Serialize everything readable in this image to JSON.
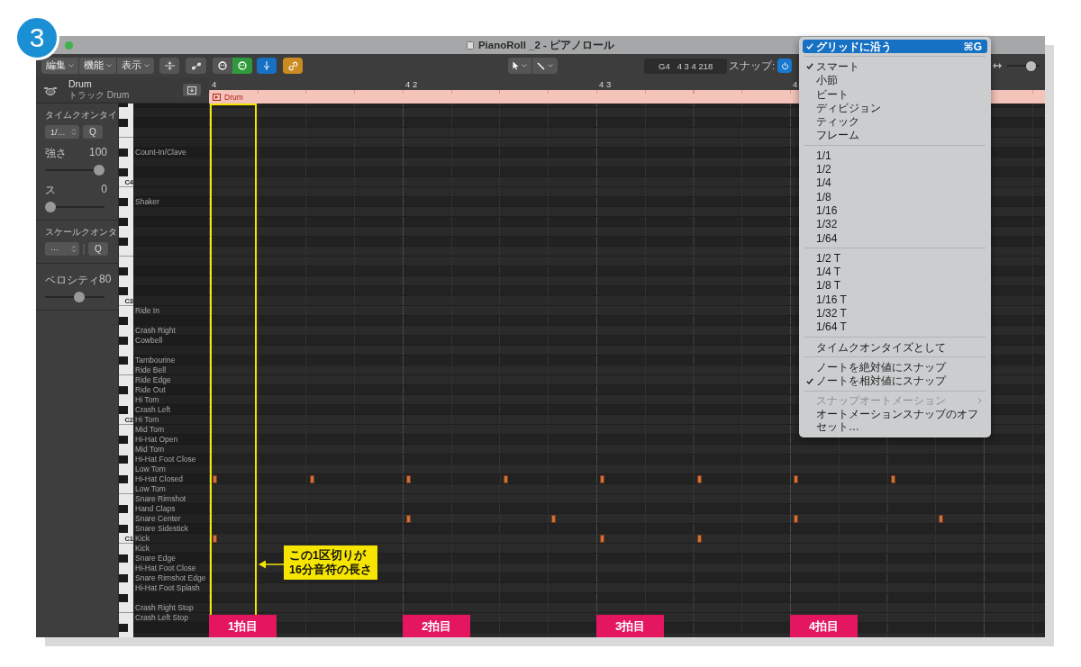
{
  "badge": "3",
  "window": {
    "title": "PianoRoll _2 - ピアノロール"
  },
  "toolbar": {
    "menus": [
      {
        "label": "編集"
      },
      {
        "label": "機能"
      },
      {
        "label": "表示"
      }
    ],
    "midi": [
      {
        "selected": false
      },
      {
        "selected": true
      }
    ],
    "catch_on": true,
    "link_on": true,
    "note": "G4",
    "position": "4 3 4 218",
    "snap_label": "スナップ:",
    "snap_on": true,
    "zoom": {
      "level": 0.85
    }
  },
  "track": {
    "name": "Drum",
    "subtitle": "トラック Drum"
  },
  "inspector": {
    "time_quantize": {
      "title": "タイムクオンタイ",
      "value": "1/…",
      "button": "Q"
    },
    "strength": {
      "label": "強さ",
      "reading": "100",
      "level": 1
    },
    "swing": {
      "label": "ス",
      "reading": "0",
      "level": 0
    },
    "scale_quantize": {
      "title": "スケールクオンタ",
      "value": "···",
      "button": "Q"
    },
    "velocity": {
      "label": "ベロシティ",
      "reading": "80",
      "level": 0.6
    }
  },
  "ruler": {
    "bars": [
      "4",
      "4 2",
      "4 3",
      "4"
    ]
  },
  "region": {
    "name": "Drum"
  },
  "octaves": [
    "C4",
    "C3",
    "C2",
    "C1"
  ],
  "lanes": [
    {
      "drum": "Count-In/Clave"
    },
    {
      "drum": "Shaker"
    },
    {
      "drum": "Ride In"
    },
    {
      "drum": "Crash Right"
    },
    {
      "drum": "Cowbell"
    },
    {
      "drum": "Tambourine"
    },
    {
      "drum": "Ride Bell"
    },
    {
      "drum": "Ride Edge"
    },
    {
      "drum": "Ride Out"
    },
    {
      "drum": "Hi Tom"
    },
    {
      "drum": "Crash Left"
    },
    {
      "drum": "Hi Tom"
    },
    {
      "drum": "Mid Tom"
    },
    {
      "drum": "Hi-Hat Open"
    },
    {
      "drum": "Mid Tom"
    },
    {
      "drum": "Hi-Hat Foot Close"
    },
    {
      "drum": "Low Tom"
    },
    {
      "drum": "Hi-Hat Closed",
      "steps": [
        true,
        false,
        true,
        false,
        true,
        false,
        true,
        false,
        true,
        false,
        true,
        false,
        true,
        false,
        true,
        false
      ]
    },
    {
      "drum": "Low Tom"
    },
    {
      "drum": "Snare Rimshot"
    },
    {
      "drum": "Hand Claps"
    },
    {
      "drum": "Snare Center",
      "steps": [
        false,
        false,
        false,
        false,
        true,
        false,
        false,
        true,
        false,
        false,
        false,
        false,
        true,
        false,
        false,
        true
      ]
    },
    {
      "drum": "Snare Sidestick"
    },
    {
      "drum": "Kick",
      "steps": [
        true,
        false,
        false,
        false,
        false,
        false,
        false,
        false,
        true,
        false,
        true,
        false,
        false,
        false,
        false,
        false
      ]
    },
    {
      "drum": "Kick"
    },
    {
      "drum": "Snare Edge"
    },
    {
      "drum": "Hi-Hat Foot Close"
    },
    {
      "drum": "Snare Rimshot Edge"
    },
    {
      "drum": "Hi-Hat Foot Splash"
    },
    {
      "drum": "Crash Right Stop"
    },
    {
      "drum": "Crash Left Stop"
    }
  ],
  "callout": {
    "lines": [
      "この1区切りが",
      "16分音符の長さ"
    ]
  },
  "beats": [
    "1拍目",
    "2拍目",
    "3拍目",
    "4拍目"
  ],
  "snap_menu": {
    "sections": [
      [
        {
          "label": "グリッドに沿う",
          "shortcut": "⌘G",
          "checked": true,
          "selected": true,
          "disabled": false,
          "has_submenu": false
        }
      ],
      [
        {
          "label": "スマート",
          "checked": true,
          "selected": false,
          "disabled": false,
          "has_submenu": false
        },
        {
          "label": "小節",
          "checked": false,
          "selected": false,
          "disabled": false,
          "has_submenu": false
        },
        {
          "label": "ビート",
          "checked": false,
          "selected": false,
          "disabled": false,
          "has_submenu": false
        },
        {
          "label": "ディビジョン",
          "checked": false,
          "selected": false,
          "disabled": false,
          "has_submenu": false
        },
        {
          "label": "ティック",
          "checked": false,
          "selected": false,
          "disabled": false,
          "has_submenu": false
        },
        {
          "label": "フレーム",
          "checked": false,
          "selected": false,
          "disabled": false,
          "has_submenu": false
        }
      ],
      [
        {
          "label": "1/1",
          "checked": false,
          "selected": false,
          "disabled": false,
          "has_submenu": false
        },
        {
          "label": "1/2",
          "checked": false,
          "selected": false,
          "disabled": false,
          "has_submenu": false
        },
        {
          "label": "1/4",
          "checked": false,
          "selected": false,
          "disabled": false,
          "has_submenu": false
        },
        {
          "label": "1/8",
          "checked": false,
          "selected": false,
          "disabled": false,
          "has_submenu": false
        },
        {
          "label": "1/16",
          "checked": false,
          "selected": false,
          "disabled": false,
          "has_submenu": false
        },
        {
          "label": "1/32",
          "checked": false,
          "selected": false,
          "disabled": false,
          "has_submenu": false
        },
        {
          "label": "1/64",
          "checked": false,
          "selected": false,
          "disabled": false,
          "has_submenu": false
        }
      ],
      [
        {
          "label": "1/2 T",
          "checked": false,
          "selected": false,
          "disabled": false,
          "has_submenu": false
        },
        {
          "label": "1/4 T",
          "checked": false,
          "selected": false,
          "disabled": false,
          "has_submenu": false
        },
        {
          "label": "1/8 T",
          "checked": false,
          "selected": false,
          "disabled": false,
          "has_submenu": false
        },
        {
          "label": "1/16 T",
          "checked": false,
          "selected": false,
          "disabled": false,
          "has_submenu": false
        },
        {
          "label": "1/32 T",
          "checked": false,
          "selected": false,
          "disabled": false,
          "has_submenu": false
        },
        {
          "label": "1/64 T",
          "checked": false,
          "selected": false,
          "disabled": false,
          "has_submenu": false
        }
      ],
      [
        {
          "label": "タイムクオンタイズとして",
          "checked": false,
          "selected": false,
          "disabled": false,
          "has_submenu": false
        }
      ],
      [
        {
          "label": "ノートを絶対値にスナップ",
          "checked": false,
          "selected": false,
          "disabled": false,
          "has_submenu": false
        },
        {
          "label": "ノートを相対値にスナップ",
          "checked": true,
          "selected": false,
          "disabled": false,
          "has_submenu": false
        }
      ],
      [
        {
          "label": "スナップオートメーション",
          "checked": false,
          "selected": false,
          "disabled": true,
          "has_submenu": true
        },
        {
          "label": "オートメーションスナップのオフセット…",
          "checked": false,
          "selected": false,
          "disabled": false,
          "has_submenu": false
        }
      ]
    ]
  }
}
